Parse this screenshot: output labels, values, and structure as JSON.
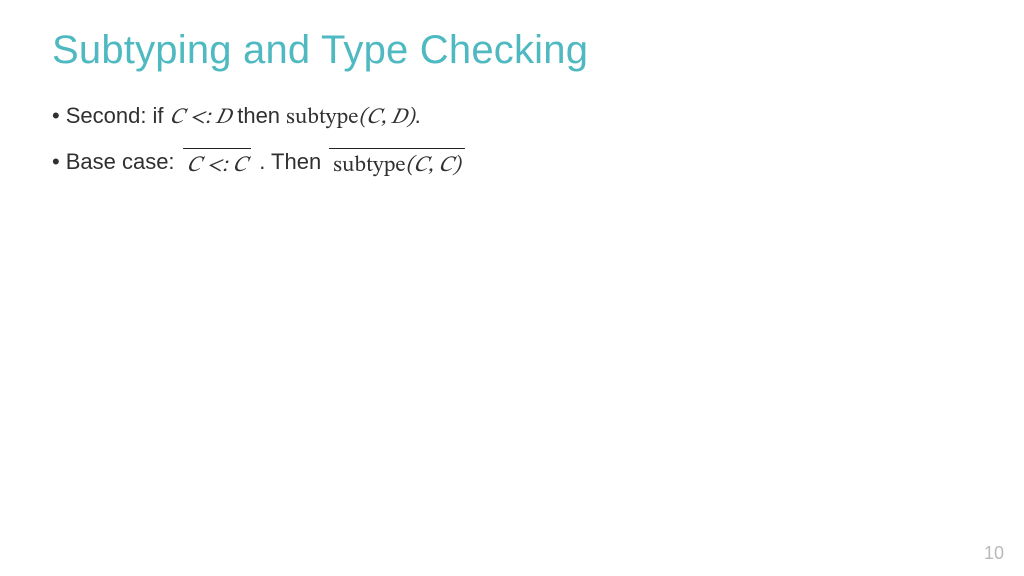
{
  "slide": {
    "title": "Subtyping and Type Checking",
    "bullets": [
      {
        "lead": "Second: if ",
        "premise": "𝐶 <: 𝐷",
        "mid": " then ",
        "conclusion_fn": "subtype",
        "conclusion_args": "(𝐶, 𝐷)",
        "tail": "."
      },
      {
        "lead": "Base case:  ",
        "rule1": "𝐶 <: 𝐶",
        "mid": " . Then ",
        "rule2_fn": "subtype",
        "rule2_args": "(𝐶, 𝐶)"
      }
    ],
    "page_number": "10"
  }
}
